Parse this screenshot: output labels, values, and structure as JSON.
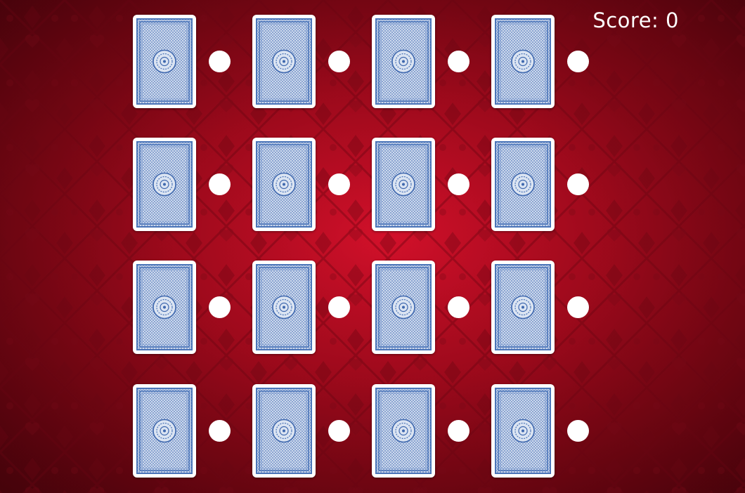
{
  "score": {
    "label": "Score:",
    "value": "0"
  },
  "theme": {
    "felt_color": "#b70b20",
    "felt_pattern_color": "#8e0718",
    "card_border_color": "#ffffff",
    "card_back_color": "#4a74b8",
    "card_back_light": "#dbe4f2",
    "selector_dot_color": "#ffffff"
  },
  "board": {
    "rows": 4,
    "columns": 4,
    "cards_face_down": 16,
    "icons": {
      "card": "card-back-medallion-icon",
      "slot": "selector-dot-icon"
    }
  }
}
